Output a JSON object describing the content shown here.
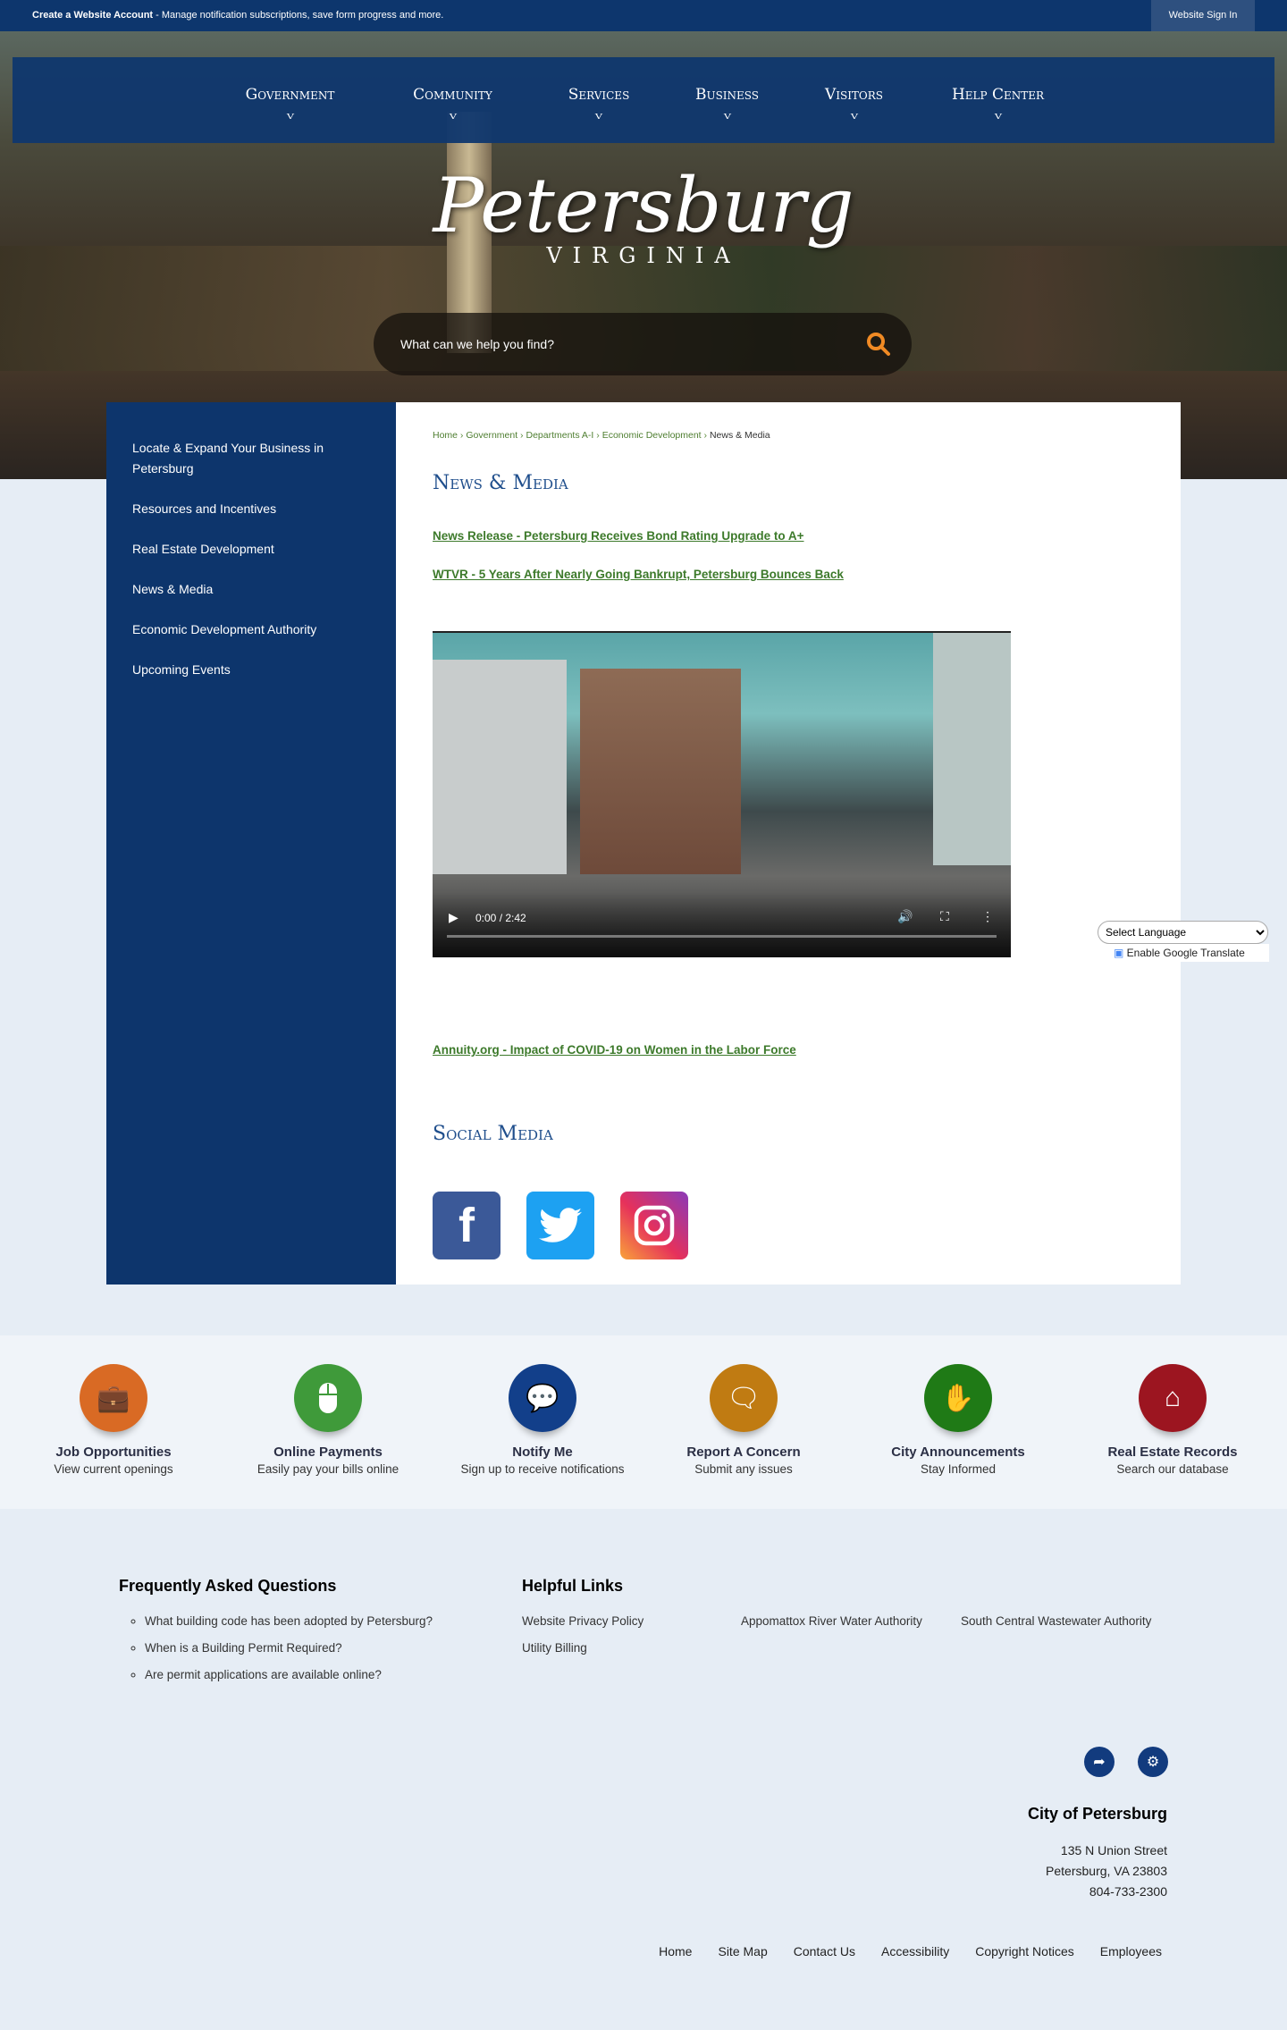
{
  "topbar": {
    "account_bold": "Create a Website Account",
    "account_text": " - Manage notification subscriptions, save form progress and more.",
    "sign_in": "Website Sign In"
  },
  "nav": [
    "Government",
    "Community",
    "Services",
    "Business",
    "Visitors",
    "Help Center"
  ],
  "logo": {
    "title": "Petersburg",
    "subtitle": "VIRGINIA"
  },
  "search": {
    "placeholder": "What can we help you find?"
  },
  "sidebar": [
    "Locate & Expand Your Business in Petersburg",
    "Resources and Incentives",
    "Real Estate Development",
    "News & Media",
    "Economic Development Authority",
    "Upcoming Events"
  ],
  "breadcrumb": {
    "items": [
      "Home",
      "Government",
      "Departments A-I",
      "Economic Development"
    ],
    "current": "News & Media"
  },
  "page": {
    "title": "News & Media",
    "links": [
      "News Release - Petersburg Receives Bond Rating Upgrade to A+",
      "WTVR - 5 Years After Nearly Going Bankrupt, Petersburg Bounces Back"
    ],
    "video": {
      "time": "0:00 / 2:42",
      "progress": 0
    },
    "link3": "Annuity.org - Impact of COVID-19 on Women in the Labor Force",
    "social_title": "Social Media",
    "social": [
      "facebook",
      "twitter",
      "instagram"
    ]
  },
  "translate": {
    "select": "Select Language",
    "enable": "Enable Google Translate"
  },
  "quick": [
    {
      "title": "Job Opportunities",
      "sub": "View current openings",
      "color": "#d96a24"
    },
    {
      "title": "Online Payments",
      "sub": "Easily pay your bills online",
      "color": "#3f9a3a"
    },
    {
      "title": "Notify Me",
      "sub": "Sign up to receive notifications",
      "color": "#123f8a"
    },
    {
      "title": "Report A Concern",
      "sub": "Submit any issues",
      "color": "#c07b12"
    },
    {
      "title": "City Announcements",
      "sub": "Stay Informed",
      "color": "#1f7a16"
    },
    {
      "title": "Real Estate Records",
      "sub": "Search our database",
      "color": "#9c1520"
    }
  ],
  "faq": {
    "title": "Frequently Asked Questions",
    "items": [
      "What building code has been adopted by Petersburg?",
      "When is a Building Permit Required?",
      "Are permit applications are available online?"
    ]
  },
  "helpful": {
    "title": "Helpful Links",
    "items": [
      "Website Privacy Policy",
      "Utility Billing",
      "Appomattox River Water Authority",
      "South Central Wastewater Authority"
    ]
  },
  "contact": {
    "title": "City of Petersburg",
    "street": "135 N Union Street",
    "city": "Petersburg, VA 23803",
    "phone": "804-733-2300"
  },
  "footer": [
    "Home",
    "Site Map",
    "Contact Us",
    "Accessibility",
    "Copyright Notices",
    "Employees"
  ]
}
